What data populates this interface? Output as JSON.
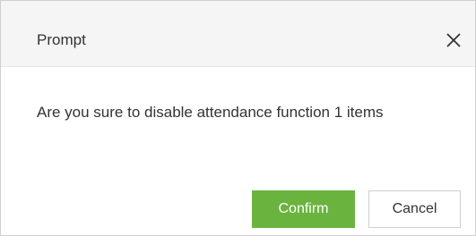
{
  "dialog": {
    "title": "Prompt",
    "close_icon": "close-icon",
    "message": "Are you sure to disable attendance function 1 items",
    "confirm_label": "Confirm",
    "cancel_label": "Cancel"
  },
  "colors": {
    "header_background": "#f5f5f5",
    "confirm_button": "#6ab33f",
    "text": "#333333",
    "border": "#cfcfcf"
  }
}
